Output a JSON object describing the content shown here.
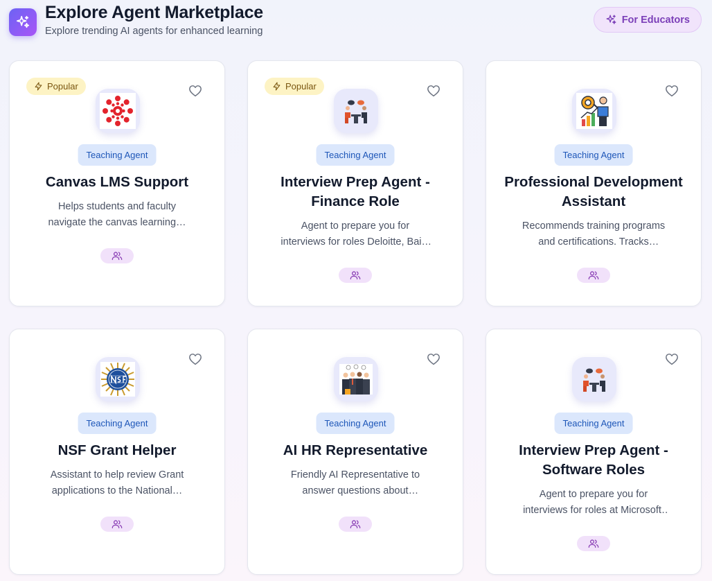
{
  "header": {
    "title": "Explore Agent Marketplace",
    "subtitle": "Explore trending AI agents for enhanced learning",
    "educator_button_label": "For Educators",
    "brand_icon": "sparkles-icon"
  },
  "colors": {
    "brand_gradient_start": "#6c63f4",
    "brand_gradient_end": "#a855f7",
    "tag_background": "#dbe7fc",
    "tag_text": "#1d56b8",
    "popular_background": "#fdf3c4",
    "users_pill_background": "#f1e1fa"
  },
  "agents": [
    {
      "badge": "Popular",
      "category": "Teaching Agent",
      "title": "Canvas LMS Support",
      "description": "Helps students and faculty navigate the canvas learning…",
      "avatar_icon": "canvas-logo-icon"
    },
    {
      "badge": "Popular",
      "category": "Teaching Agent",
      "title": "Interview Prep Agent - Finance Role",
      "description": "Agent to prepare you for interviews for roles Deloitte, Bain, Accenture…",
      "avatar_icon": "interview-icon"
    },
    {
      "category": "Teaching Agent",
      "title": "Professional Development Assistant",
      "description": "Recommends training programs and certifications. Tracks progres…",
      "avatar_icon": "presenter-chart-icon"
    },
    {
      "category": "Teaching Agent",
      "title": "NSF Grant Helper",
      "description": "Assistant to help review Grant applications to the National…",
      "avatar_icon": "nsf-seal-icon"
    },
    {
      "category": "Teaching Agent",
      "title": "AI HR Representative",
      "description": "Friendly AI Representative to answer questions about vacation…",
      "avatar_icon": "hr-team-icon"
    },
    {
      "category": "Teaching Agent",
      "title": "Interview Prep Agent - Software Roles",
      "description": "Agent to prepare you for interviews for roles at Microsoft, Netflix,…",
      "avatar_icon": "interview-icon"
    }
  ]
}
